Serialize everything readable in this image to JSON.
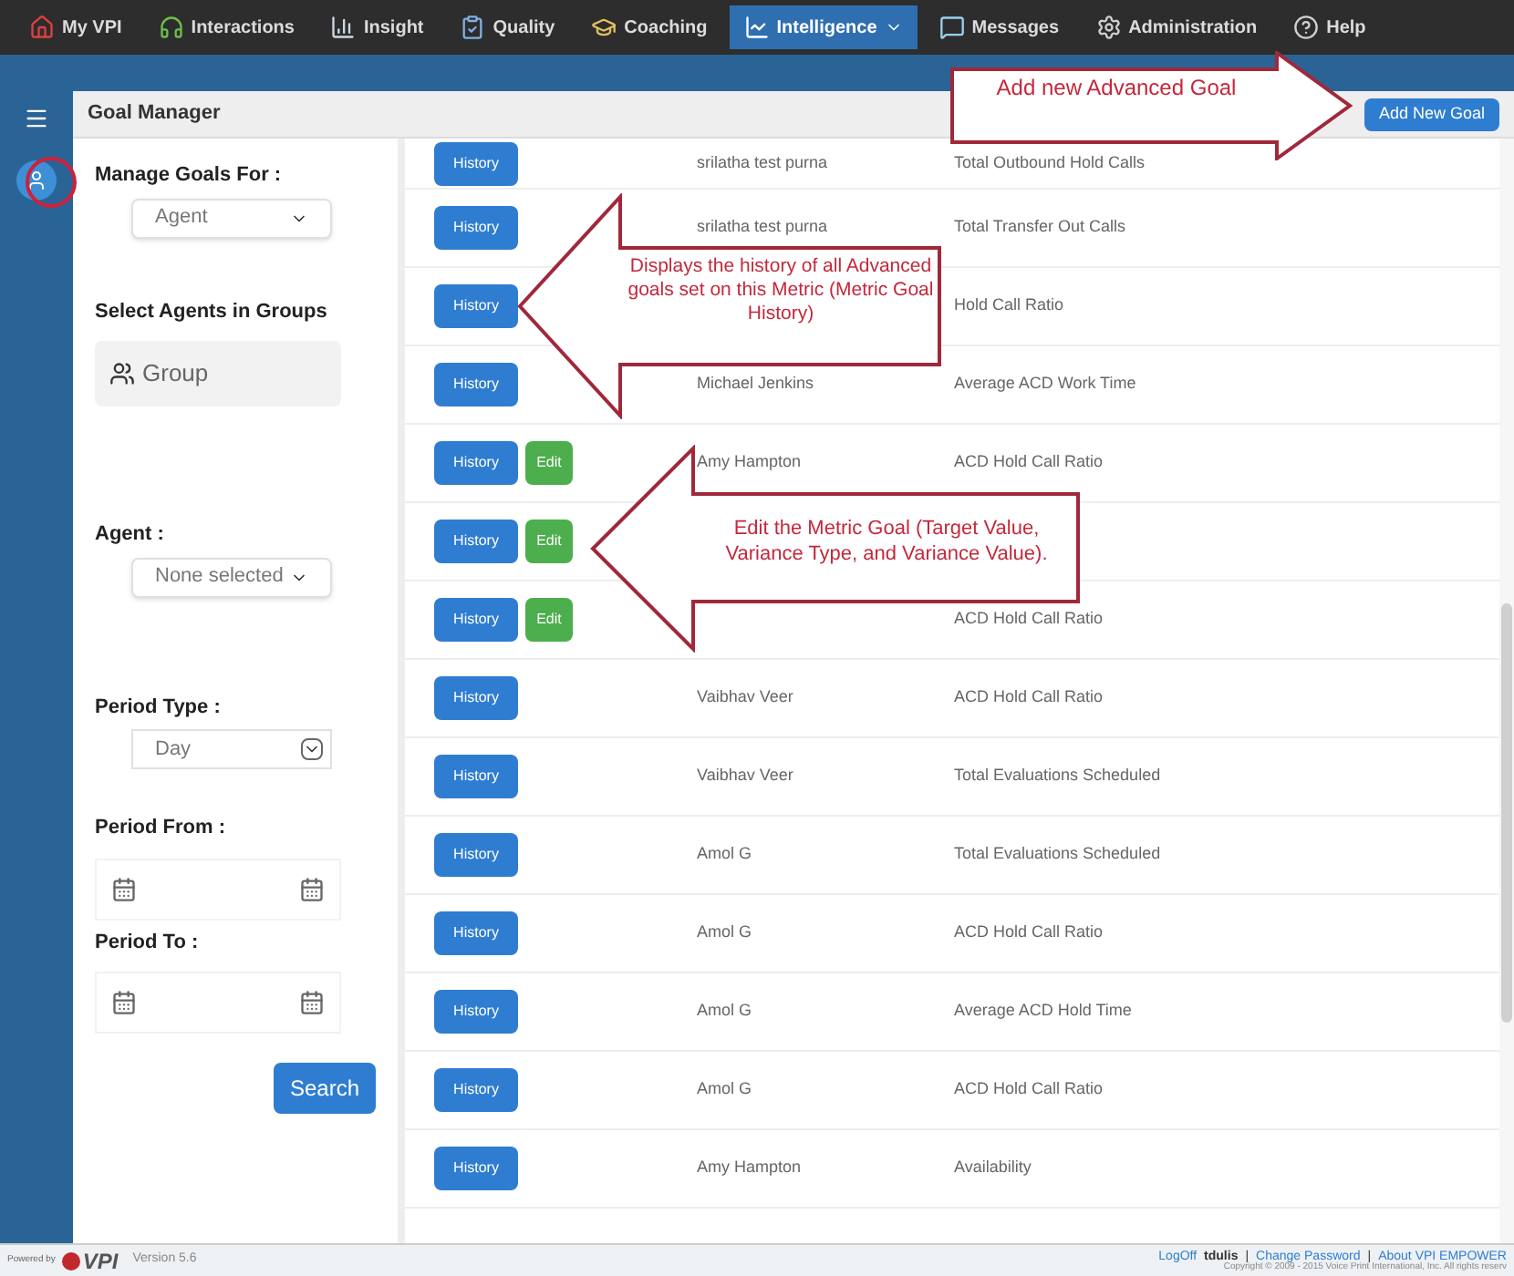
{
  "nav": [
    {
      "label": "My VPI",
      "selected": false,
      "dropdown": false
    },
    {
      "label": "Interactions",
      "selected": false,
      "dropdown": false
    },
    {
      "label": "Insight",
      "selected": false,
      "dropdown": false
    },
    {
      "label": "Quality",
      "selected": false,
      "dropdown": false
    },
    {
      "label": "Coaching",
      "selected": false,
      "dropdown": false
    },
    {
      "label": "Intelligence",
      "selected": true,
      "dropdown": true
    },
    {
      "label": "Messages",
      "selected": false,
      "dropdown": false
    },
    {
      "label": "Administration",
      "selected": false,
      "dropdown": false
    },
    {
      "label": "Help",
      "selected": false,
      "dropdown": false
    }
  ],
  "page": {
    "title": "Goal Manager",
    "add_button": "Add New Goal"
  },
  "filters": [
    {
      "kind": "select",
      "label": "Manage Goals For :",
      "value": "Agent"
    },
    {
      "kind": "group",
      "label": "Select Agents in Groups",
      "value": "Group"
    },
    {
      "kind": "select",
      "label": "Agent :",
      "value": "None selected"
    },
    {
      "kind": "native",
      "label": "Period Type :",
      "value": "Day"
    },
    {
      "kind": "dates",
      "label": "Period From :"
    },
    {
      "kind": "dates",
      "label": "Period To :"
    }
  ],
  "search_button": "Search",
  "rows": [
    {
      "buttons": [
        {
          "kind": "history",
          "label": "History"
        }
      ],
      "agent": "srilatha test purna",
      "metric": "Total Outbound Hold Calls"
    },
    {
      "buttons": [
        {
          "kind": "history",
          "label": "History"
        }
      ],
      "agent": "srilatha test purna",
      "metric": "Total Transfer Out Calls"
    },
    {
      "buttons": [
        {
          "kind": "history",
          "label": "History"
        }
      ],
      "metric": "Hold Call Ratio"
    },
    {
      "buttons": [
        {
          "kind": "history",
          "label": "History"
        }
      ],
      "agent": "Michael Jenkins",
      "metric": "Average ACD Work Time"
    },
    {
      "buttons": [
        {
          "kind": "history",
          "label": "History"
        },
        {
          "kind": "edit",
          "label": "Edit"
        }
      ],
      "agent": "Amy Hampton",
      "metric": "ACD Hold Call Ratio"
    },
    {
      "buttons": [
        {
          "kind": "history",
          "label": "History"
        },
        {
          "kind": "edit",
          "label": "Edit"
        }
      ]
    },
    {
      "buttons": [
        {
          "kind": "history",
          "label": "History"
        },
        {
          "kind": "edit",
          "label": "Edit"
        }
      ],
      "metric": "ACD Hold Call Ratio"
    },
    {
      "buttons": [
        {
          "kind": "history",
          "label": "History"
        }
      ],
      "agent": "Vaibhav Veer",
      "metric": "ACD Hold Call Ratio"
    },
    {
      "buttons": [
        {
          "kind": "history",
          "label": "History"
        }
      ],
      "agent": "Vaibhav Veer",
      "metric": "Total Evaluations Scheduled"
    },
    {
      "buttons": [
        {
          "kind": "history",
          "label": "History"
        }
      ],
      "agent": "Amol G",
      "metric": "Total Evaluations Scheduled"
    },
    {
      "buttons": [
        {
          "kind": "history",
          "label": "History"
        }
      ],
      "agent": "Amol G",
      "metric": "ACD Hold Call Ratio"
    },
    {
      "buttons": [
        {
          "kind": "history",
          "label": "History"
        }
      ],
      "agent": "Amol G",
      "metric": "Average ACD Hold Time"
    },
    {
      "buttons": [
        {
          "kind": "history",
          "label": "History"
        }
      ],
      "agent": "Amol G",
      "metric": "ACD Hold Call Ratio"
    },
    {
      "buttons": [
        {
          "kind": "history",
          "label": "History"
        }
      ],
      "agent": "Amy Hampton",
      "metric": "Availability"
    }
  ],
  "callouts": [
    {
      "kind": "right",
      "text": "Add new Advanced Goal"
    },
    {
      "kind": "left",
      "text": "Displays the history of all Advanced goals set on this Metric (Metric Goal History)"
    },
    {
      "kind": "left",
      "text": "Edit the Metric Goal (Target Value, Variance Type, and Variance Value)."
    }
  ],
  "footer": {
    "powered": "Powered by",
    "logo": "VPI",
    "version": "Version 5.6",
    "logoff": "LogOff",
    "user": "tdulis",
    "sep1": "|",
    "change_password": "Change Password",
    "sep2": "|",
    "about": "About VPI EMPOWER",
    "copyright": "Copyright © 2009 - 2015 Voice Print International, Inc. All rights reserv"
  }
}
